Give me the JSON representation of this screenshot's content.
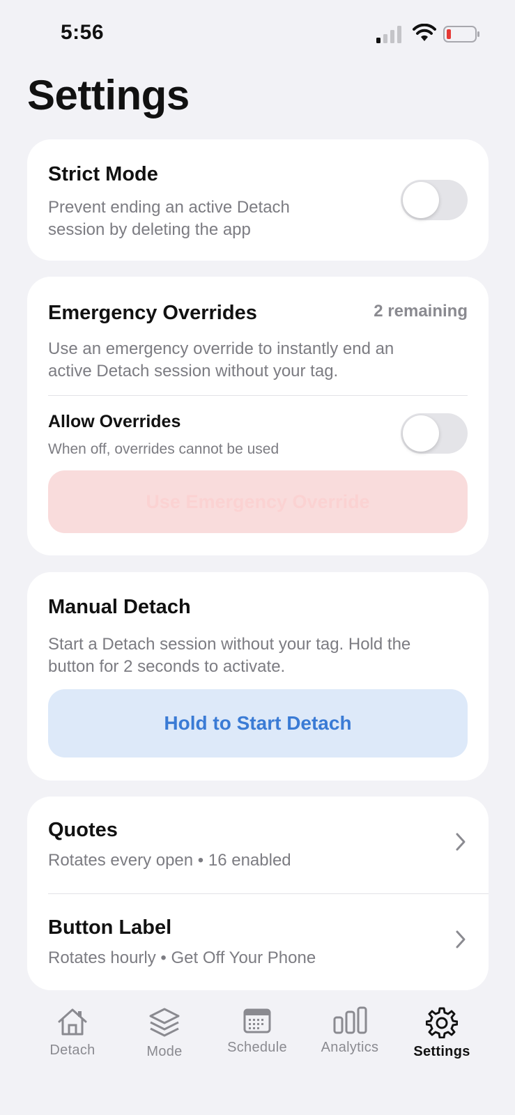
{
  "status": {
    "time": "5:56"
  },
  "page": {
    "title": "Settings"
  },
  "strict_mode": {
    "title": "Strict Mode",
    "desc_line1": "Prevent ending an active Detach",
    "desc_line2": "session by deleting the app",
    "enabled": false
  },
  "emergency": {
    "title": "Emergency Overrides",
    "remaining": "2 remaining",
    "desc_line1": "Use an emergency override to instantly end an",
    "desc_line2": "active Detach session without your tag.",
    "allow_title": "Allow Overrides",
    "allow_desc": "When off, overrides cannot be used",
    "allow_enabled": false,
    "button_label": "Use Emergency Override"
  },
  "manual": {
    "title": "Manual Detach",
    "desc_line1": "Start a Detach session without your tag. Hold the",
    "desc_line2": "button for 2 seconds to activate.",
    "button_label": "Hold to Start Detach"
  },
  "list": [
    {
      "title": "Quotes",
      "subtitle": "Rotates every open • 16 enabled"
    },
    {
      "title": "Button Label",
      "subtitle": "Rotates hourly • Get Off Your Phone"
    }
  ],
  "tabs": [
    {
      "label": "Detach",
      "icon": "house-icon"
    },
    {
      "label": "Mode",
      "icon": "layers-icon"
    },
    {
      "label": "Schedule",
      "icon": "calendar-icon"
    },
    {
      "label": "Analytics",
      "icon": "bar-chart-icon"
    },
    {
      "label": "Settings",
      "icon": "gear-icon",
      "active": true
    }
  ],
  "colors": {
    "background": "#f2f2f6",
    "accent_blue": "#3a7bd5",
    "override_red_bg": "#f9dcdc"
  }
}
